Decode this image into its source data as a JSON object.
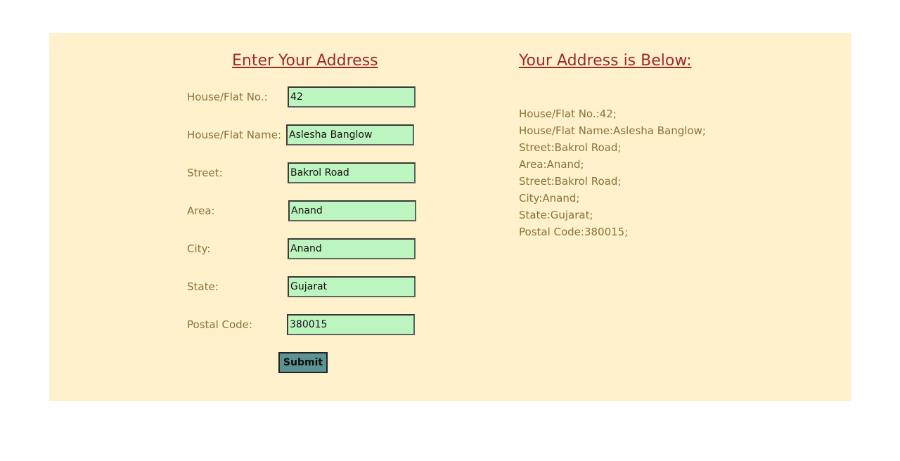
{
  "form": {
    "title": "Enter Your Address",
    "fields": [
      {
        "label": "House/Flat No.:",
        "value": "42"
      },
      {
        "label": "House/Flat Name:",
        "value": "Aslesha Banglow"
      },
      {
        "label": "Street:",
        "value": "Bakrol Road"
      },
      {
        "label": "Area:",
        "value": "Anand"
      },
      {
        "label": "City:",
        "value": "Anand"
      },
      {
        "label": "State:",
        "value": "Gujarat"
      },
      {
        "label": "Postal Code:",
        "value": "380015"
      }
    ],
    "submit_label": "Submit"
  },
  "output": {
    "title": "Your Address is Below:",
    "lines": [
      "House/Flat No.:42;",
      "House/Flat Name:Aslesha Banglow;",
      "Street:Bakrol Road;",
      "Area:Anand;",
      "Street:Bakrol Road;",
      "City:Anand;",
      "State:Gujarat;",
      "Postal Code:380015;"
    ]
  },
  "colors": {
    "panel_background": "#fff1cc",
    "heading": "#9e2a2b",
    "label_text": "#8a7238",
    "field_background": "#bdf5c0",
    "button_background": "#5b9293"
  }
}
